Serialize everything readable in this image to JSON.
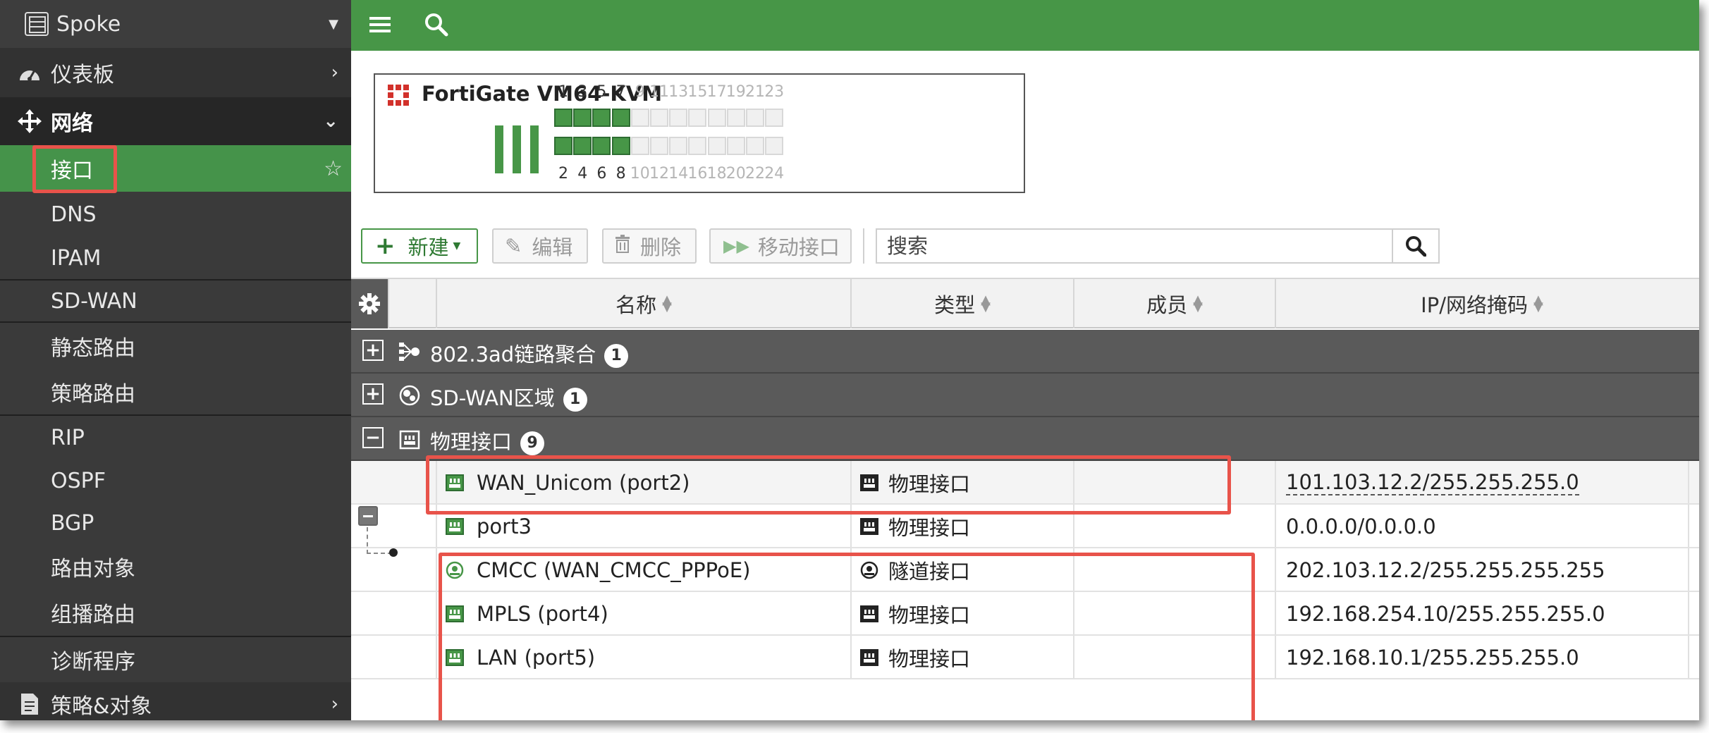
{
  "sidebar": {
    "device_selector": "Spoke",
    "items": [
      {
        "label": "仪表板"
      },
      {
        "label": "网络"
      },
      {
        "label": "接口"
      },
      {
        "label": "DNS"
      },
      {
        "label": "IPAM"
      },
      {
        "label": "SD-WAN"
      },
      {
        "label": "静态路由"
      },
      {
        "label": "策略路由"
      },
      {
        "label": "RIP"
      },
      {
        "label": "OSPF"
      },
      {
        "label": "BGP"
      },
      {
        "label": "路由对象"
      },
      {
        "label": "组播路由"
      },
      {
        "label": "诊断程序"
      },
      {
        "label": "策略&对象"
      }
    ]
  },
  "device": {
    "model": "FortiGate VM64-KVM",
    "top_ports": [
      "1",
      "3",
      "5",
      "7",
      "9",
      "11",
      "13",
      "15",
      "17",
      "19",
      "21",
      "23"
    ],
    "bottom_ports": [
      "2",
      "4",
      "6",
      "8",
      "10",
      "12",
      "14",
      "16",
      "18",
      "20",
      "22",
      "24"
    ],
    "active_ports": 4
  },
  "toolbar": {
    "new_label": "新建",
    "edit_label": "编辑",
    "delete_label": "删除",
    "move_label": "移动接口",
    "search_placeholder": "搜索"
  },
  "table": {
    "columns": [
      "名称",
      "类型",
      "成员",
      "IP/网络掩码"
    ],
    "groups": [
      {
        "label": "802.3ad链路聚合",
        "count": "1",
        "expanded": false
      },
      {
        "label": "SD-WAN区域",
        "count": "1",
        "expanded": false
      },
      {
        "label": "物理接口",
        "count": "9",
        "expanded": true
      }
    ],
    "rows": [
      {
        "name": "WAN_Unicom (port2)",
        "type": "物理接口",
        "members": "",
        "ip": "101.103.12.2/255.255.255.0"
      },
      {
        "name": "port3",
        "type": "物理接口",
        "members": "",
        "ip": "0.0.0.0/0.0.0.0"
      },
      {
        "name": "CMCC (WAN_CMCC_PPPoE)",
        "type": "隧道接口",
        "members": "",
        "ip": "202.103.12.2/255.255.255.255"
      },
      {
        "name": "MPLS (port4)",
        "type": "物理接口",
        "members": "",
        "ip": "192.168.254.10/255.255.255.0"
      },
      {
        "name": "LAN (port5)",
        "type": "物理接口",
        "members": "",
        "ip": "192.168.10.1/255.255.255.0"
      }
    ]
  },
  "colors": {
    "brand_green": "#479647",
    "sidebar_bg": "#323232",
    "highlight_red": "#e8534a"
  }
}
